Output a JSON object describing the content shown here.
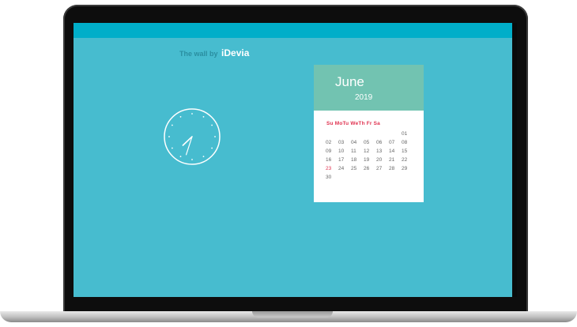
{
  "brand": {
    "prefix": "The wall by",
    "name": "iDevia"
  },
  "calendar": {
    "month": "June",
    "year": "2019",
    "weekdays": "Su MoTu WeTh Fr  Sa",
    "cells": [
      "",
      "",
      "",
      "",
      "",
      "",
      "01",
      "02",
      "03",
      "04",
      "05",
      "06",
      "07",
      "08",
      "09",
      "10",
      "11",
      "12",
      "13",
      "14",
      "15",
      "16",
      "17",
      "18",
      "19",
      "20",
      "21",
      "22",
      "23",
      "24",
      "25",
      "26",
      "27",
      "28",
      "29",
      "30",
      "",
      "",
      "",
      "",
      "",
      ""
    ],
    "highlighted": "23"
  },
  "clock": {
    "hour": 7,
    "minute": 33
  },
  "colors": {
    "wallpaper": "#47bccf",
    "topbar": "#00aec9",
    "calendar_header": "#72c3b1",
    "calendar_accent": "#e0314f"
  }
}
